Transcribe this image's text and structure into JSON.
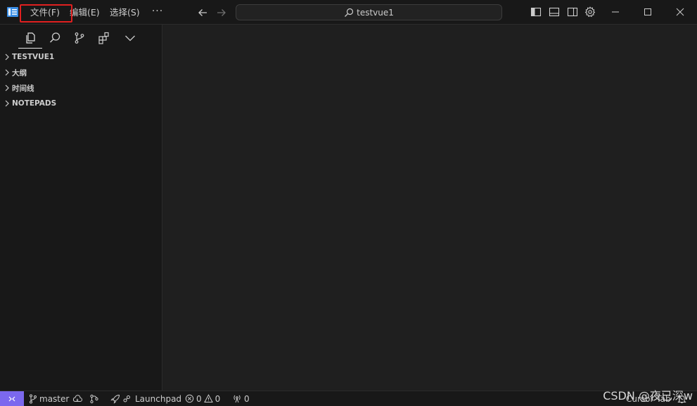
{
  "titlebar": {
    "menu": [
      {
        "label": "文件(F)"
      },
      {
        "label": "编辑(E)"
      },
      {
        "label": "选择(S)"
      }
    ],
    "more_label": "···",
    "search_text": "testvue1",
    "highlight_color": "#e02020"
  },
  "sidebar": {
    "activity_icons": [
      "explorer-icon",
      "search-icon",
      "source-control-icon",
      "extensions-icon",
      "chevron-down-icon"
    ],
    "sections": [
      {
        "label": "TESTVUE1"
      },
      {
        "label": "大纲"
      },
      {
        "label": "时间线"
      },
      {
        "label": "NOTEPADS"
      }
    ]
  },
  "statusbar": {
    "branch": "master",
    "launchpad": "Launchpad",
    "errors": "0",
    "warnings": "0",
    "ports": "0",
    "cursor_tab": "Cursor Tab",
    "remote_color": "#7b68ee"
  },
  "watermark": "CSDN @夜已深w"
}
